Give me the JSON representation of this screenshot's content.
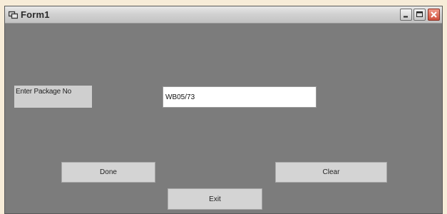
{
  "window": {
    "title": "Form1",
    "controls": {
      "minimize_icon": "minimize-icon",
      "maximize_icon": "maximize-icon",
      "close_icon": "close-icon"
    }
  },
  "form": {
    "package_label": "Enter Package No",
    "package_input_value": "WB05/73",
    "done_label": "Done",
    "clear_label": "Clear",
    "exit_label": "Exit"
  },
  "colors": {
    "form_background": "#7c7c7c",
    "button_face": "#d4d4d4",
    "close_button": "#d0503c"
  }
}
